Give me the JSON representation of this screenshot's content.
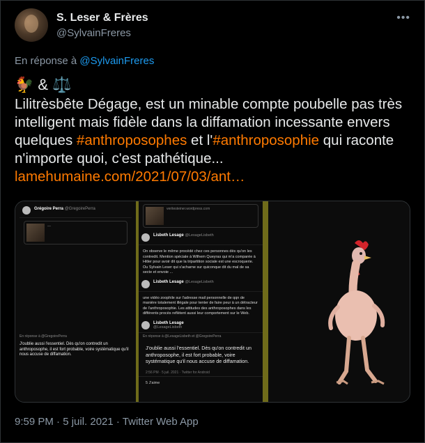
{
  "author": {
    "display_name": "S. Leser & Frères",
    "handle": "@SylvainFreres"
  },
  "more_icon": "more-horizontal-icon",
  "reply_to": {
    "prefix": "En réponse à ",
    "mention": "@SylvainFreres"
  },
  "emoji_line": {
    "first": "🐓",
    "amp": "&",
    "second": "⚖️"
  },
  "tweet": {
    "part1": "Lilitrèsbête Dégage, est un minable compte poubelle pas très intelligent mais fidèle dans la diffamation incessante envers quelques ",
    "hashtag1": "#anthroposophes",
    "part2": " et l'",
    "hashtag2": "#anthroposophie",
    "part3": " qui raconte n'importe quoi, c'est pathétique...",
    "link": "lamehumaine.com/2021/07/03/ant…"
  },
  "media": {
    "left": {
      "name": "Grégoire Perra",
      "handle": "@GregoirePerra",
      "line1": "En réponse à @GregoirePerra",
      "line2": "J'oublie aussi l'essentiel. Dès qu'on contredit un anthroposophe, il est fort probable, voire systématique qu'il nous accuse de diffamation."
    },
    "mid": {
      "site": "veritesteiner.wordpress.com",
      "author": "Lisbeth Lesage",
      "author_handle": "@LesageLisbeth",
      "tweet1": "On observe le même procédé chez ces personnes dès qu'on les contredit. Mention spéciale à Wilhem Queyras qui m'a comparée à Hitler pour avoir dit que la tripartition sociale est une escroquerie. Ou Sylvain Leser qui s'acharne sur quiconque dit du mal de sa secte et envoie ...",
      "tweet2": "une vidéo zoophile sur l'adresse mail personnelle de qqn de manière totalement illégale pour tenter de faire peur à un détracteur de l'anthroposophie. Les attitudes des anthroposophes dans les différents procès reflètent aussi leur comportement sur le Web.",
      "reply_line": "En réponse à @LesageLisbeth et @GregoirePerra",
      "quote": "J'oublie aussi l'essentiel. Dès qu'on contredit un anthroposophe, il est fort probable, voire systématique qu'il nous accuse de diffamation.",
      "meta": "2:56 PM · 5 juil. 2021 · Twitter for Android",
      "likes": "5 J'aime"
    }
  },
  "timestamp": "9:59 PM · 5 juil. 2021 · Twitter Web App",
  "colors": {
    "background": "#000000",
    "text": "#e7e9ea",
    "secondary": "#8b98a5",
    "mention": "#1d9bf0",
    "hashtag": "#ff7a00"
  }
}
